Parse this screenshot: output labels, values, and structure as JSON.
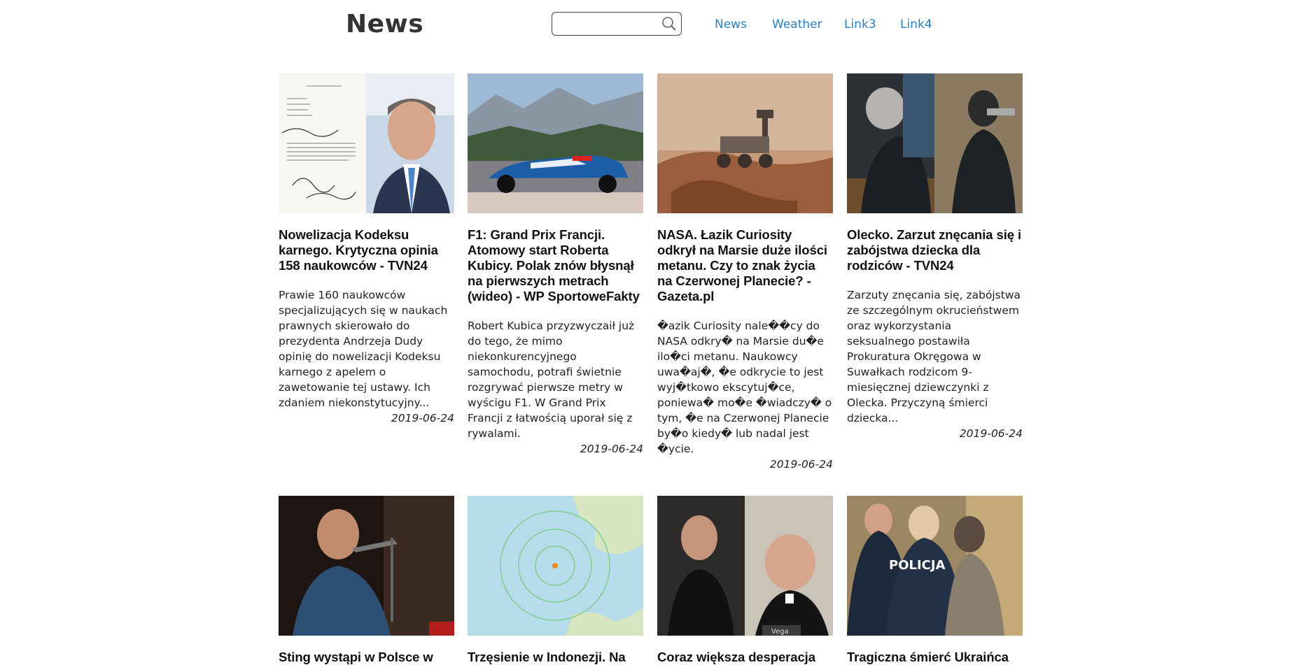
{
  "header": {
    "logo": "News",
    "search": {
      "value": "",
      "placeholder": ""
    },
    "nav": [
      "News",
      "Weather",
      "Link3",
      "Link4"
    ]
  },
  "colors": {
    "link": "#2a7fc0",
    "text": "#222222",
    "background": "#ffffff"
  },
  "articles": [
    {
      "title": "Nowelizacja Kodeksu karnego. Krytyczna opinia 158 naukowców - TVN24",
      "description": "Prawie 160 naukowców specjalizujących się w naukach prawnych skierowało do prezydenta Andrzeja Dudy opinię do nowelizacji Kodeksu karnego z apelem o zawetowanie tej ustawy. Ich zdaniem niekonstytucyjny...",
      "date": "2019-06-24",
      "image": "letter-and-president-photo"
    },
    {
      "title": "F1: Grand Prix Francji. Atomowy start Roberta Kubicy. Polak znów błysnął na pierwszych metrach (wideo) - WP SportoweFakty",
      "description": "Robert Kubica przyzwyczaił już do tego, że mimo niekonkurencyjnego samochodu, potrafi świetnie rozgrywać pierwsze metry w wyścigu F1. W Grand Prix Francji z łatwością uporał się z rywalami.",
      "date": "2019-06-24",
      "image": "f1-car-photo"
    },
    {
      "title": "NASA. Łazik Curiosity odkrył na Marsie duże ilości metanu. Czy to znak życia na Czerwonej Planecie? - Gazeta.pl",
      "description": "�azik Curiosity nale��cy do NASA odkry� na Marsie du�e ilo�ci metanu. Naukowcy uwa�aj�, �e odkrycie to jest wyj�tkowo ekscytuj�ce, poniewa� mo�e �wiadczy� o tym, �e na Czerwonej Planecie by�o kiedy� lub nadal jest �ycie.",
      "date": "2019-06-24",
      "image": "mars-rover-photo"
    },
    {
      "title": "Olecko. Zarzut znęcania się i zabójstwa dziecka dla rodziców - TVN24",
      "description": "Zarzuty znęcania się, zabójstwa ze szczególnym okrucieństwem oraz wykorzystania seksualnego postawiła Prokuratura Okręgowa w Suwałkach rodzicom 9-miesięcznej dziewczynki z Olecka. Przyczyną śmierci dziecka...",
      "date": "2019-06-24",
      "image": "police-arrest-photo"
    },
    {
      "title": "Sting wystąpi w Polsce w",
      "image": "singer-photo"
    },
    {
      "title": "Trzęsienie w Indonezji. Na",
      "image": "earthquake-map"
    },
    {
      "title": "Coraz większa desperacja",
      "image": "two-men-photo",
      "image_caption": "Vega"
    },
    {
      "title": "Tragiczna śmierć Ukraińca",
      "image": "police-officers-photo",
      "image_badge": "POLICJA"
    }
  ]
}
